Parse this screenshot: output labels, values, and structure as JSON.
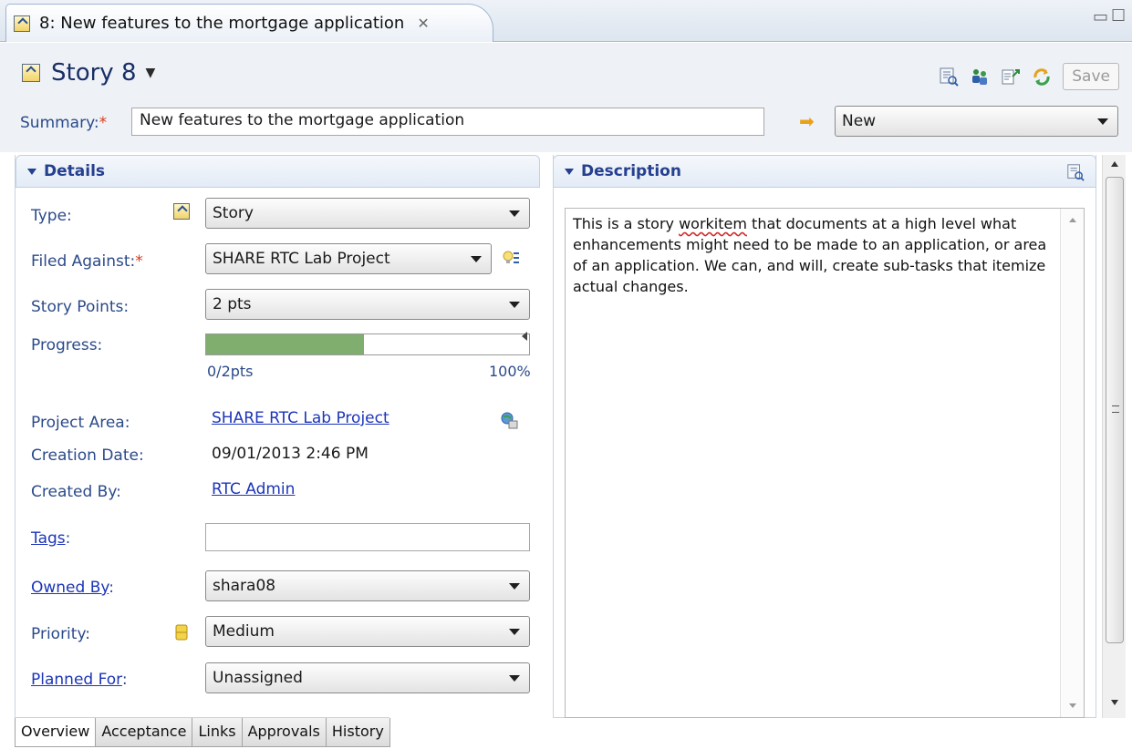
{
  "editor_tab": {
    "title": "8: New features to the mortgage application"
  },
  "header": {
    "story_title": "Story 8",
    "save_label": "Save",
    "summary_label": "Summary:",
    "required_mark": "*",
    "summary_value": "New features to the mortgage application",
    "state_value": "New"
  },
  "details": {
    "title": "Details",
    "type": {
      "label": "Type:",
      "value": "Story"
    },
    "filed_against": {
      "label": "Filed Against:",
      "value": "SHARE RTC Lab Project"
    },
    "story_points": {
      "label": "Story Points:",
      "value": "2 pts"
    },
    "progress": {
      "label": "Progress:",
      "left_text": "0/2pts",
      "right_text": "100%",
      "fill_fraction": 0.49
    },
    "project_area": {
      "label": "Project Area:",
      "value": "SHARE RTC Lab Project"
    },
    "creation_date": {
      "label": "Creation Date:",
      "value": "09/01/2013 2:46 PM"
    },
    "created_by": {
      "label": "Created By:",
      "value": "RTC Admin"
    },
    "tags": {
      "label": "Tags",
      "suffix": ":",
      "value": ""
    },
    "owned_by": {
      "label": "Owned By",
      "suffix": ":",
      "value": "shara08"
    },
    "priority": {
      "label": "Priority:",
      "value": "Medium"
    },
    "planned_for": {
      "label": "Planned For",
      "suffix": ":",
      "value": "Unassigned"
    }
  },
  "description": {
    "title": "Description",
    "text_before": "This is a story ",
    "text_misspelled": "workitem",
    "text_after": " that documents at a high level what enhancements might need to be made to an application, or area of an application. We can, and will, create sub-tasks that itemize actual changes."
  },
  "bottom_tabs": [
    "Overview",
    "Acceptance",
    "Links",
    "Approvals",
    "History"
  ],
  "colors": {
    "link": "#1c35b8",
    "label": "#2b4a8a",
    "required": "#d83a1a",
    "progress_fill": "#7fae6f"
  }
}
